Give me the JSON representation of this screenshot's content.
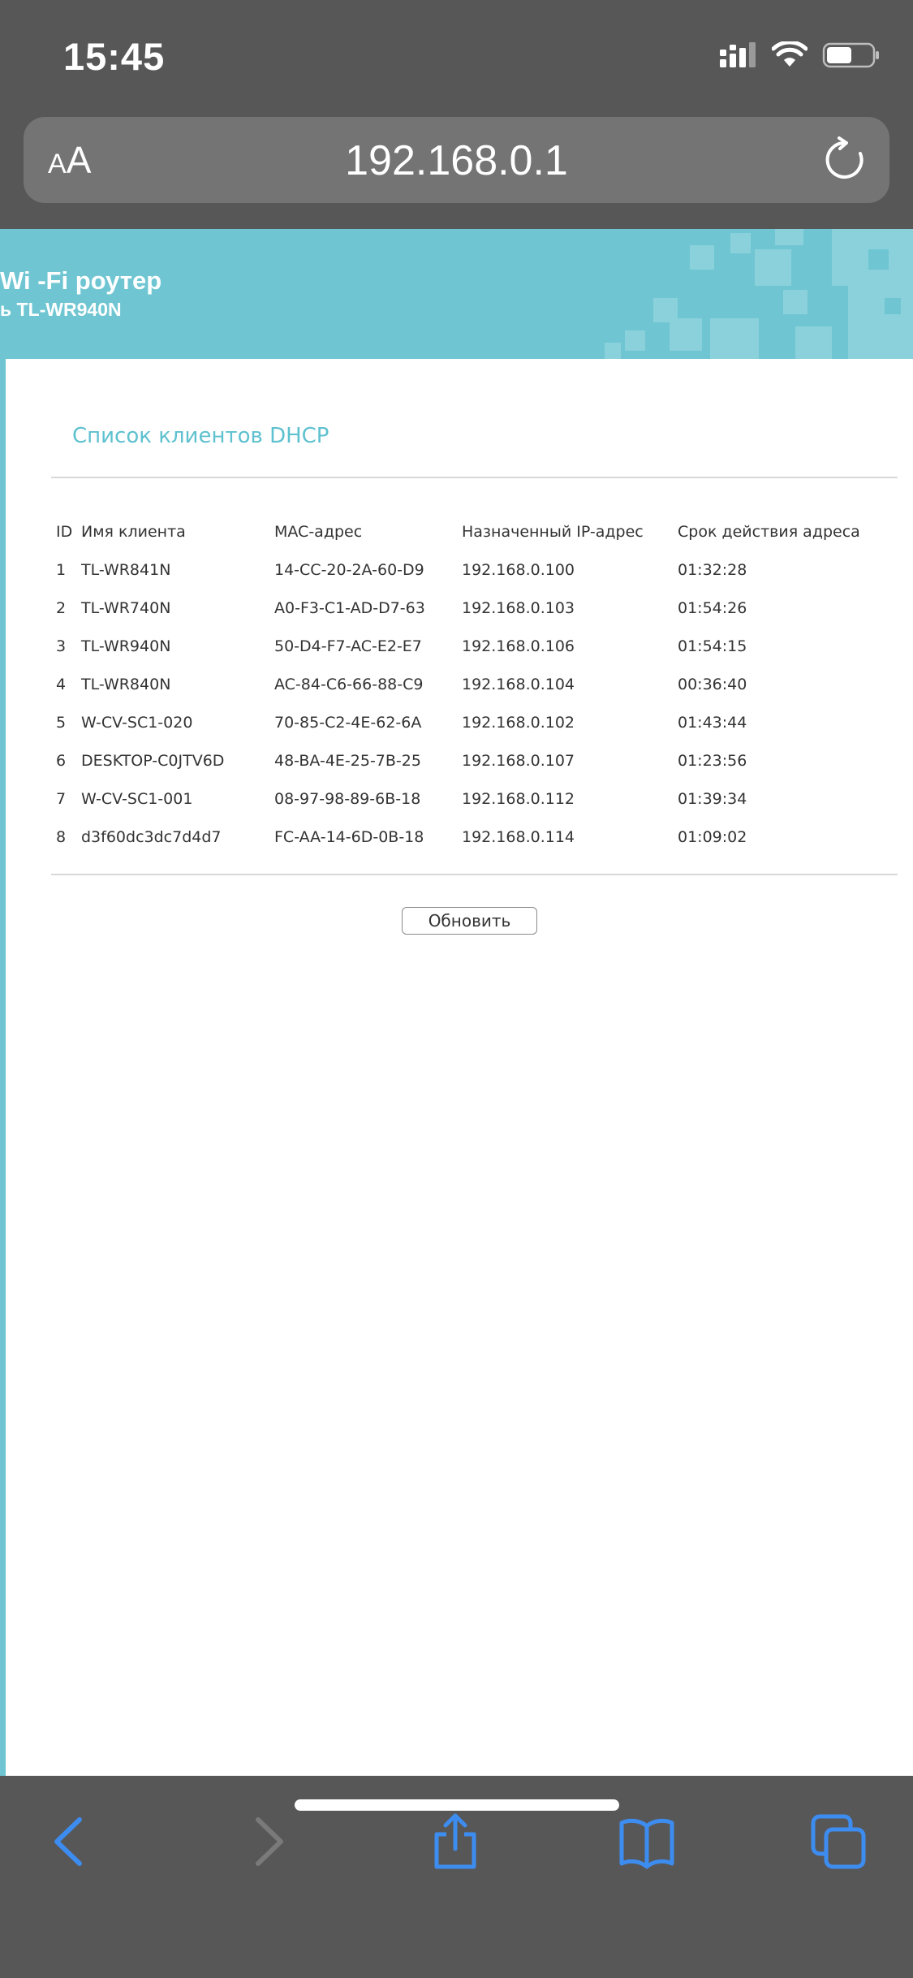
{
  "status_bar": {
    "time": "15:45"
  },
  "browser": {
    "text_size_small": "A",
    "text_size_large": "A",
    "url": "192.168.0.1"
  },
  "router_header": {
    "title": "Wi -Fi роутер",
    "subtitle": "ь TL-WR940N"
  },
  "dhcp": {
    "title": "Список клиентов DHCP",
    "columns": [
      "ID",
      "Имя клиента",
      "MAC-адрес",
      "Назначенный IP-адрес",
      "Срок действия адреса"
    ],
    "rows": [
      [
        "1",
        "TL-WR841N",
        "14-CC-20-2A-60-D9",
        "192.168.0.100",
        "01:32:28"
      ],
      [
        "2",
        "TL-WR740N",
        "A0-F3-C1-AD-D7-63",
        "192.168.0.103",
        "01:54:26"
      ],
      [
        "3",
        "TL-WR940N",
        "50-D4-F7-AC-E2-E7",
        "192.168.0.106",
        "01:54:15"
      ],
      [
        "4",
        "TL-WR840N",
        "AC-84-C6-66-88-C9",
        "192.168.0.104",
        "00:36:40"
      ],
      [
        "5",
        "W-CV-SC1-020",
        "70-85-C2-4E-62-6A",
        "192.168.0.102",
        "01:43:44"
      ],
      [
        "6",
        "DESKTOP-C0JTV6D",
        "48-BA-4E-25-7B-25",
        "192.168.0.107",
        "01:23:56"
      ],
      [
        "7",
        "W-CV-SC1-001",
        "08-97-98-89-6B-18",
        "192.168.0.112",
        "01:39:34"
      ],
      [
        "8",
        "d3f60dc3dc7d4d7",
        "FC-AA-14-6D-0B-18",
        "192.168.0.114",
        "01:09:02"
      ]
    ],
    "refresh_label": "Обновить"
  },
  "icons": {
    "signal": "cellular-signal-icon",
    "wifi": "wifi-icon",
    "battery": "battery-icon",
    "reload": "reload-icon",
    "back": "chevron-left-icon",
    "forward": "chevron-right-icon",
    "share": "share-icon",
    "bookmarks": "book-icon",
    "tabs": "tabs-icon"
  },
  "colors": {
    "chrome": "#575757",
    "accent": "#6fc6d2",
    "link_blue": "#3d8cf0"
  }
}
